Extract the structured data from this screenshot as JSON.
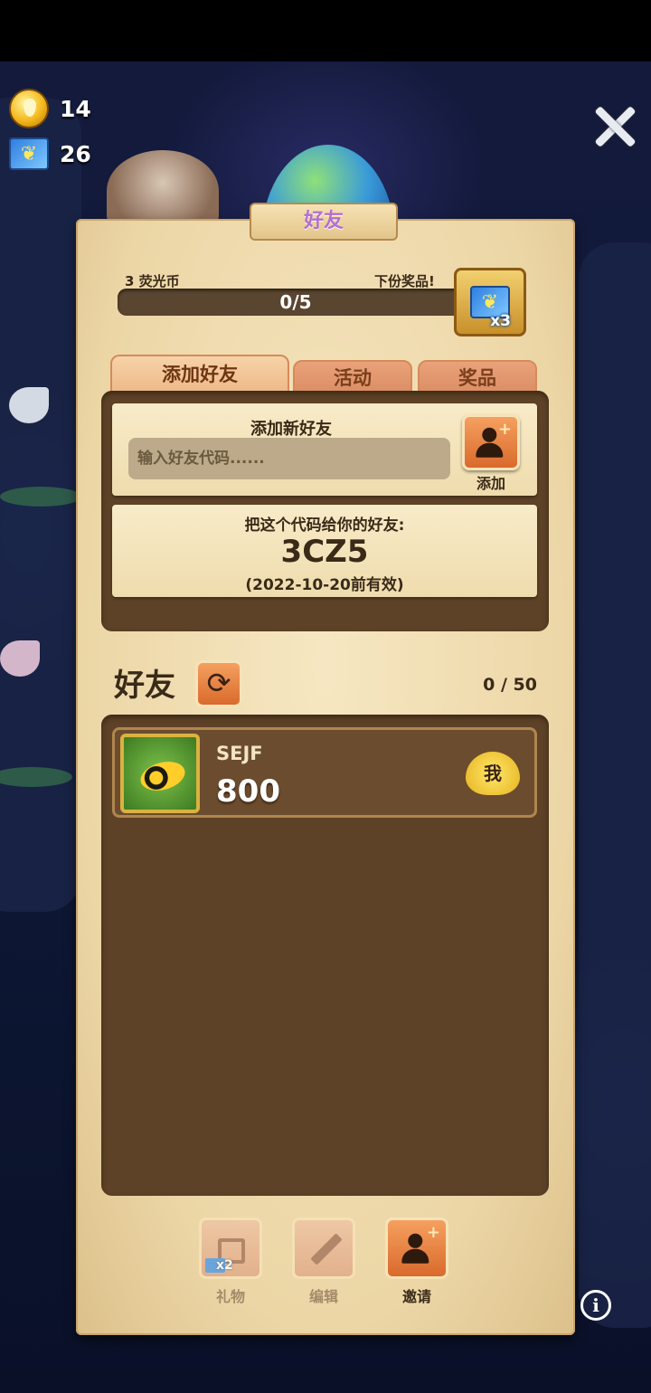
{
  "currency": {
    "drops": "14",
    "butterflies": "26"
  },
  "header": {
    "title": "好友"
  },
  "progress": {
    "left_label": "3 荧光币",
    "right_label": "下份奖品!",
    "text": "0/5",
    "current": 0,
    "total": 5,
    "reward_multiplier": "x3"
  },
  "tabs": [
    {
      "label": "添加好友",
      "active": true
    },
    {
      "label": "活动",
      "active": false
    },
    {
      "label": "奖品",
      "active": false
    }
  ],
  "add_friend": {
    "title": "添加新好友",
    "placeholder": "输入好友代码......",
    "button_label": "添加"
  },
  "share_code": {
    "title": "把这个代码给你的好友:",
    "code": "3CZ5",
    "validity": "(2022-10-20前有效)"
  },
  "friends": {
    "title": "好友",
    "count": "0 / 50",
    "list": [
      {
        "name": "SEJF",
        "score": "800",
        "badge": "我"
      }
    ]
  },
  "actions": [
    {
      "label": "礼物",
      "badge": "x2",
      "enabled": false
    },
    {
      "label": "编辑",
      "enabled": false
    },
    {
      "label": "邀请",
      "enabled": true
    }
  ],
  "icons": {
    "drop": "drop-icon",
    "butterfly": "butterfly-icon",
    "close": "close-icon",
    "info": "info-icon",
    "refresh": "refresh-icon",
    "add_person": "add-person-icon",
    "gift": "gift-icon",
    "pencil": "pencil-icon"
  },
  "colors": {
    "accent": "#d96a2c",
    "parchment": "#ecd6a6",
    "panel_dark": "#5e4227"
  }
}
